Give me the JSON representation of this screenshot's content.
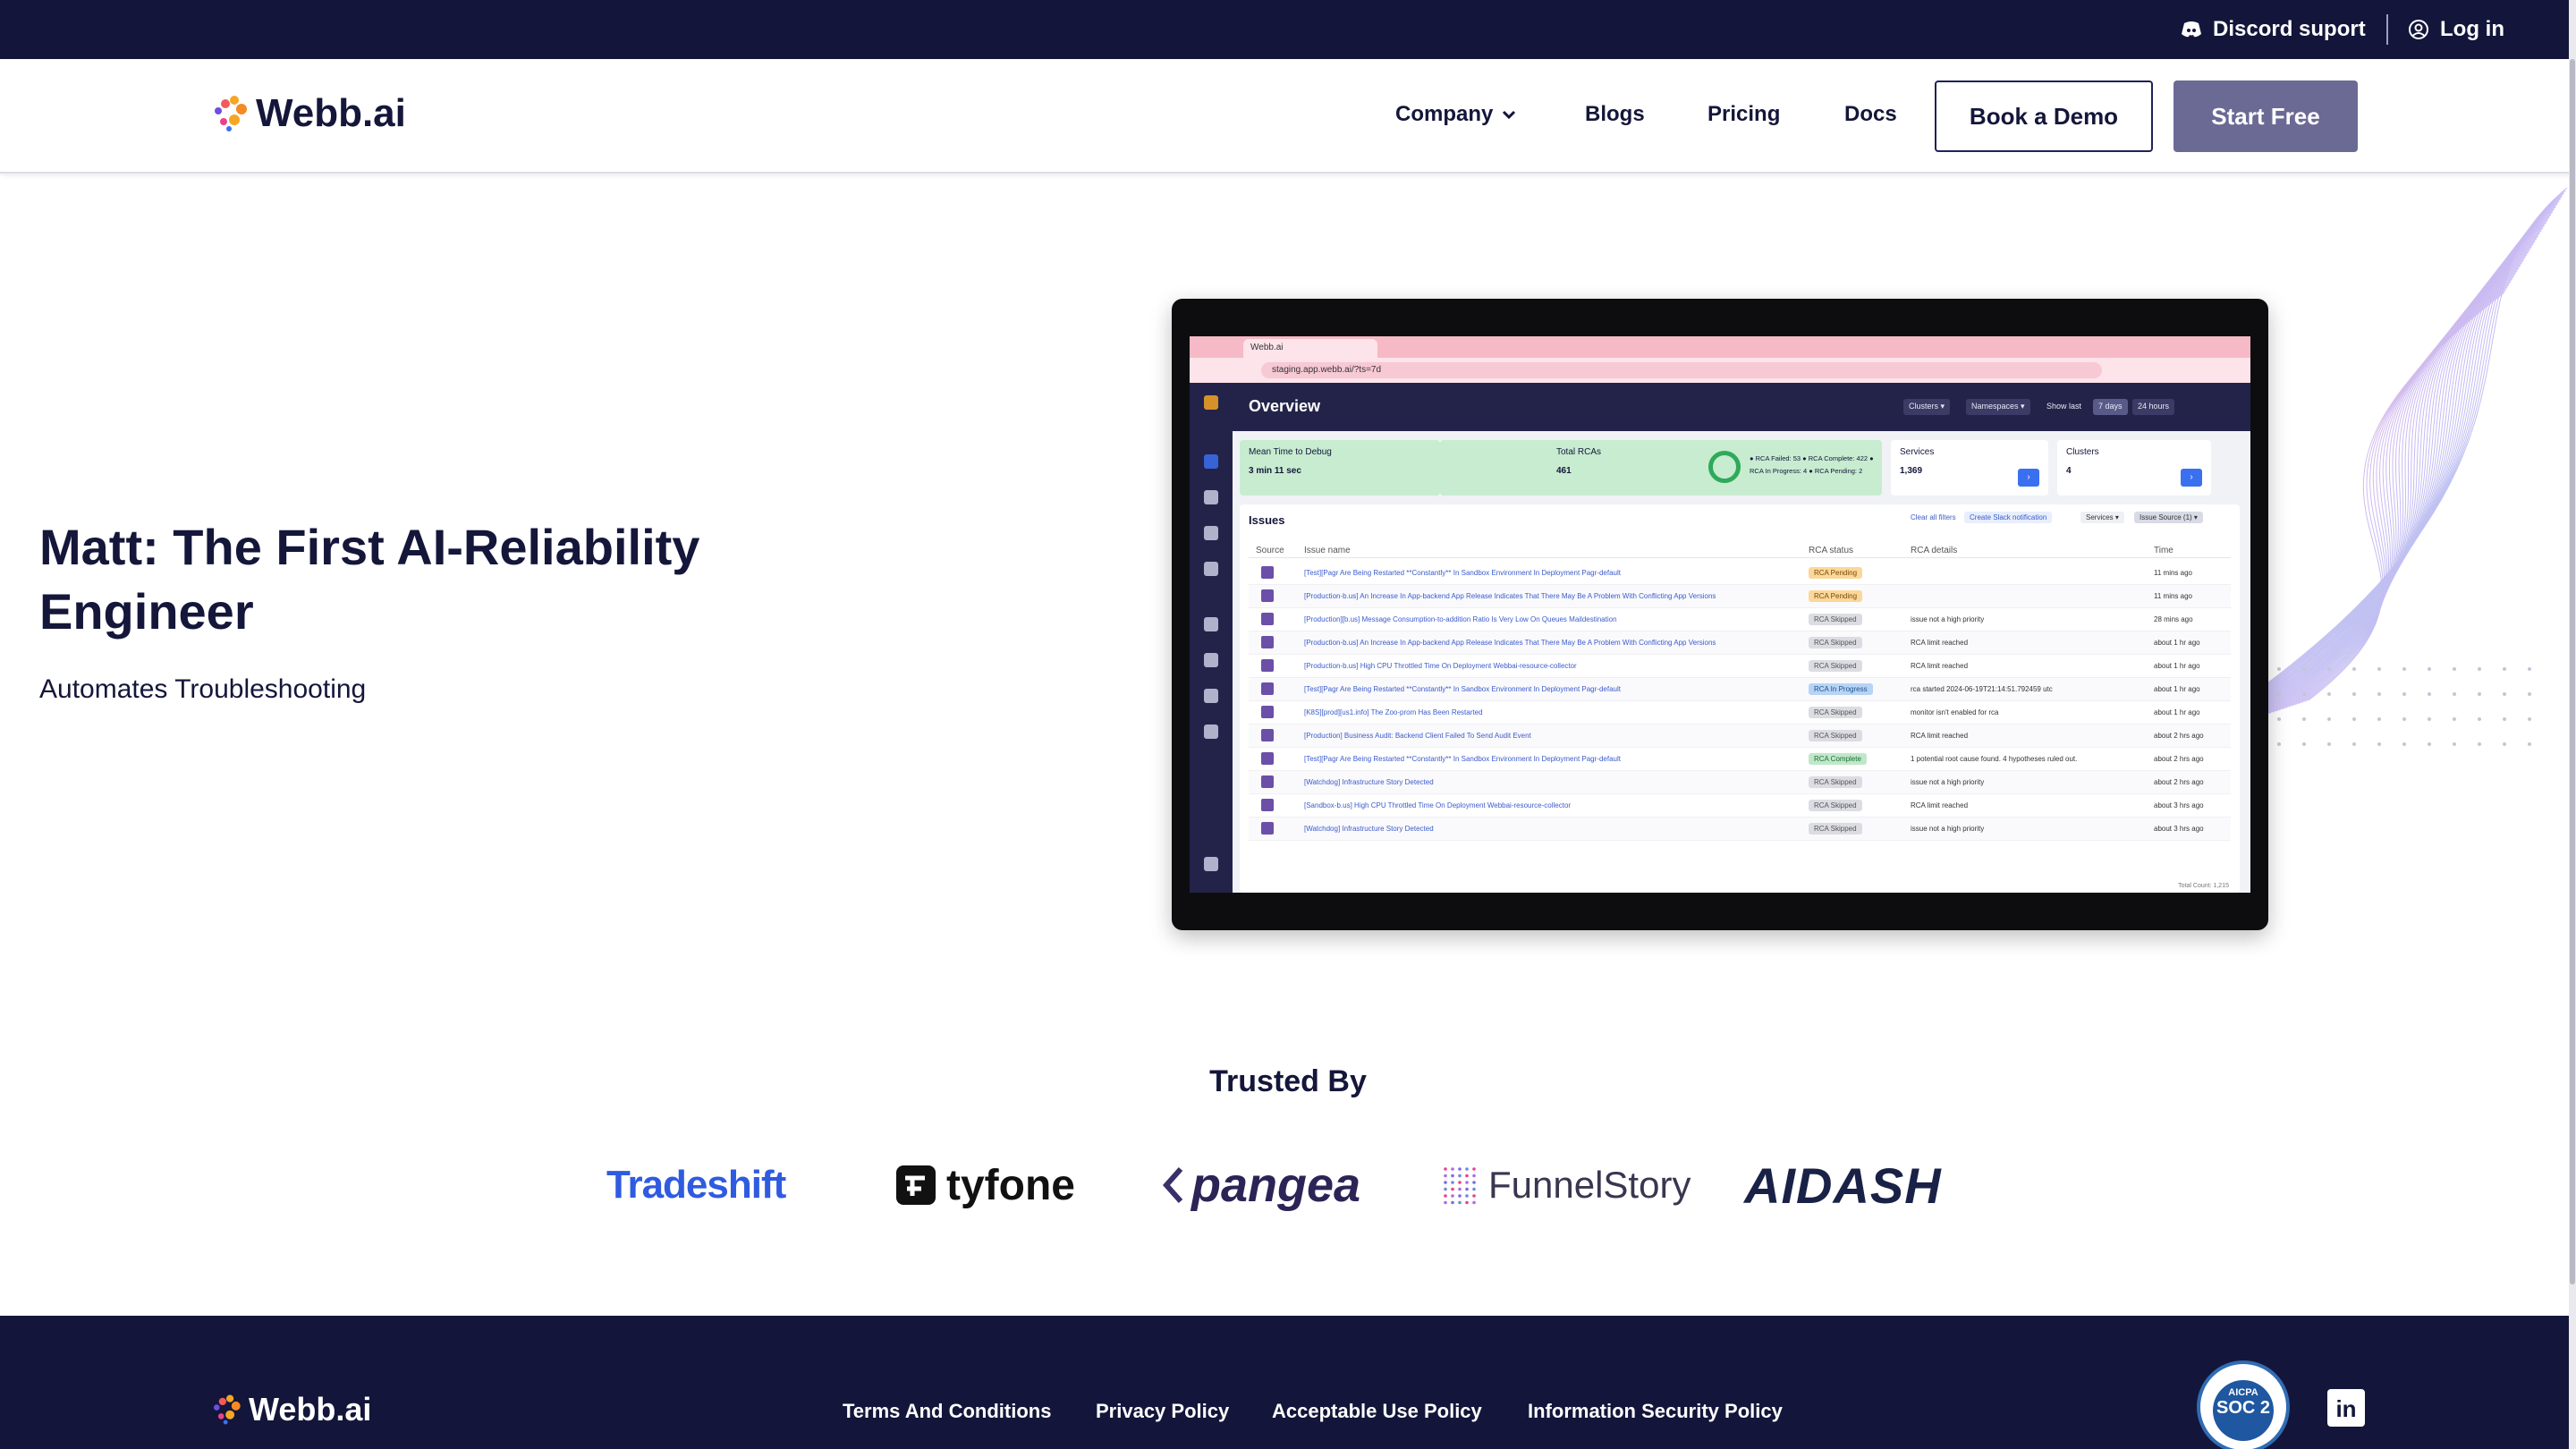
{
  "topbar": {
    "discord_label": "Discord suport",
    "login_label": "Log in"
  },
  "nav": {
    "brand": "Webb.ai",
    "company_label": "Company",
    "blogs_label": "Blogs",
    "pricing_label": "Pricing",
    "docs_label": "Docs",
    "book_demo_label": "Book a Demo",
    "start_free_label": "Start Free"
  },
  "hero": {
    "title": "Matt: The First AI-Reliability Engineer",
    "subtitle": "Automates Troubleshooting"
  },
  "screenshot": {
    "tab_title": "Webb.ai",
    "url": "staging.app.webb.ai/?ts=7d",
    "page_title": "Overview",
    "chips": [
      "Clusters ▾",
      "Namespaces ▾",
      "Show last",
      "7 days",
      "24 hours"
    ],
    "cards": {
      "mttd_label": "Mean Time to Debug",
      "mttd_value": "3 min 11 sec",
      "total_rcas_label": "Total RCAs",
      "total_rcas_value": "461",
      "legend": "● RCA Failed: 53  ● RCA Complete: 422  ● RCA In Progress: 4  ● RCA Pending: 2",
      "services_label": "Services",
      "services_value": "1,369",
      "clusters_label": "Clusters",
      "clusters_value": "4"
    },
    "issues_title": "Issues",
    "issues_actions": [
      "Clear all filters",
      "Create Slack notification",
      "Services ▾",
      "Issue Source (1) ▾"
    ],
    "columns": [
      "Source",
      "Issue name",
      "RCA status",
      "RCA details",
      "Time"
    ],
    "rows": [
      {
        "name": "[Test][Pagr Are Being Restarted **Constantly** In Sandbox Environment In Deployment Pagr-default",
        "status": "RCA Pending",
        "details": "",
        "time": "11 mins ago"
      },
      {
        "name": "[Production-b.us] An Increase In App-backend App Release Indicates That There May Be A Problem With Conflicting App Versions",
        "status": "RCA Pending",
        "details": "",
        "time": "11 mins ago"
      },
      {
        "name": "[Production][b.us] Message Consumption-to-addition Ratio Is Very Low On Queues Maildestination",
        "status": "RCA Skipped",
        "details": "issue not a high priority",
        "time": "28 mins ago"
      },
      {
        "name": "[Production-b.us] An Increase In App-backend App Release Indicates That There May Be A Problem With Conflicting App Versions",
        "status": "RCA Skipped",
        "details": "RCA limit reached",
        "time": "about 1 hr ago"
      },
      {
        "name": "[Production-b.us] High CPU Throttled Time On Deployment Webbai-resource-collector",
        "status": "RCA Skipped",
        "details": "RCA limit reached",
        "time": "about 1 hr ago"
      },
      {
        "name": "[Test][Pagr Are Being Restarted **Constantly** In Sandbox Environment In Deployment Pagr-default",
        "status": "RCA In Progress",
        "details": "rca started 2024-06-19T21:14:51.792459 utc",
        "time": "about 1 hr ago"
      },
      {
        "name": "[K8S][prod][us1.info] The Zoo-prom Has Been Restarted",
        "status": "RCA Skipped",
        "details": "monitor isn't enabled for rca",
        "time": "about 1 hr ago"
      },
      {
        "name": "[Production] Business Audit: Backend Client Failed To Send Audit Event",
        "status": "RCA Skipped",
        "details": "RCA limit reached",
        "time": "about 2 hrs ago"
      },
      {
        "name": "[Test][Pagr Are Being Restarted **Constantly** In Sandbox Environment In Deployment Pagr-default",
        "status": "RCA Complete",
        "details": "1 potential root cause found. 4 hypotheses ruled out.",
        "time": "about 2 hrs ago"
      },
      {
        "name": "[Watchdog] Infrastructure Story Detected",
        "status": "RCA Skipped",
        "details": "issue not a high priority",
        "time": "about 2 hrs ago"
      },
      {
        "name": "[Sandbox-b.us] High CPU Throttled Time On Deployment Webbai-resource-collector",
        "status": "RCA Skipped",
        "details": "RCA limit reached",
        "time": "about 3 hrs ago"
      },
      {
        "name": "[Watchdog] Infrastructure Story Detected",
        "status": "RCA Skipped",
        "details": "issue not a high priority",
        "time": "about 3 hrs ago"
      }
    ],
    "total_count": "Total Count: 1,215"
  },
  "trusted": {
    "heading": "Trusted By",
    "logos": [
      "Tradeshift",
      "tyfone",
      "pangea",
      "FunnelStory",
      "AIDASH"
    ]
  },
  "footer": {
    "brand": "Webb.ai",
    "links": [
      "Terms And Conditions",
      "Privacy Policy",
      "Acceptable Use Policy",
      "Information Security Policy"
    ],
    "soc_top": "AICPA",
    "soc_main": "SOC 2",
    "linkedin": "in"
  },
  "colors": {
    "navy": "#13163a",
    "start_button": "#6b6a95",
    "accent_blue": "#2f5be0"
  }
}
